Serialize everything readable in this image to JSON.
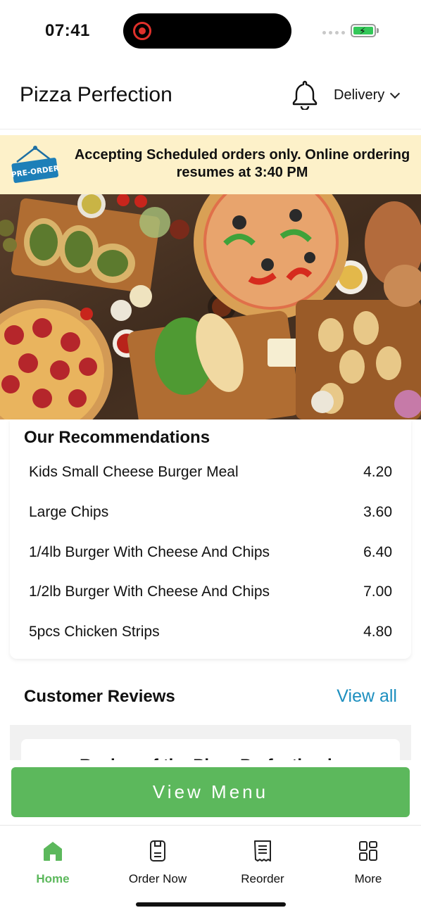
{
  "status_bar": {
    "time": "07:41"
  },
  "header": {
    "title": "Pizza Perfection",
    "mode": "Delivery",
    "notification_icon": "bell-icon"
  },
  "banner": {
    "tag": "PRE-ORDER",
    "message": "Accepting Scheduled orders only. Online ordering resumes at 3:40 PM",
    "background": "#fdf1c9"
  },
  "hero": {
    "icon": "food-photo"
  },
  "recommendations": {
    "title": "Our Recommendations",
    "items": [
      {
        "name": "Kids Small Cheese Burger Meal",
        "price": "4.20"
      },
      {
        "name": "Large Chips",
        "price": "3.60"
      },
      {
        "name": "1/4lb Burger With Cheese And Chips",
        "price": "6.40"
      },
      {
        "name": "1/2lb Burger With Cheese And Chips",
        "price": "7.00"
      },
      {
        "name": "5pcs Chicken Strips",
        "price": "4.80"
      }
    ]
  },
  "reviews": {
    "title": "Customer Reviews",
    "view_all": "View all",
    "peek_text": "Review of the Pizza Perfection is"
  },
  "view_menu_label": "View Menu",
  "tabs": [
    {
      "label": "Home",
      "icon": "home-icon",
      "active": true
    },
    {
      "label": "Order Now",
      "icon": "order-icon",
      "active": false
    },
    {
      "label": "Reorder",
      "icon": "receipt-icon",
      "active": false
    },
    {
      "label": "More",
      "icon": "grid-icon",
      "active": false
    }
  ],
  "colors": {
    "accent": "#5cb85c",
    "link": "#1d8fbf",
    "record": "#e0312b"
  }
}
